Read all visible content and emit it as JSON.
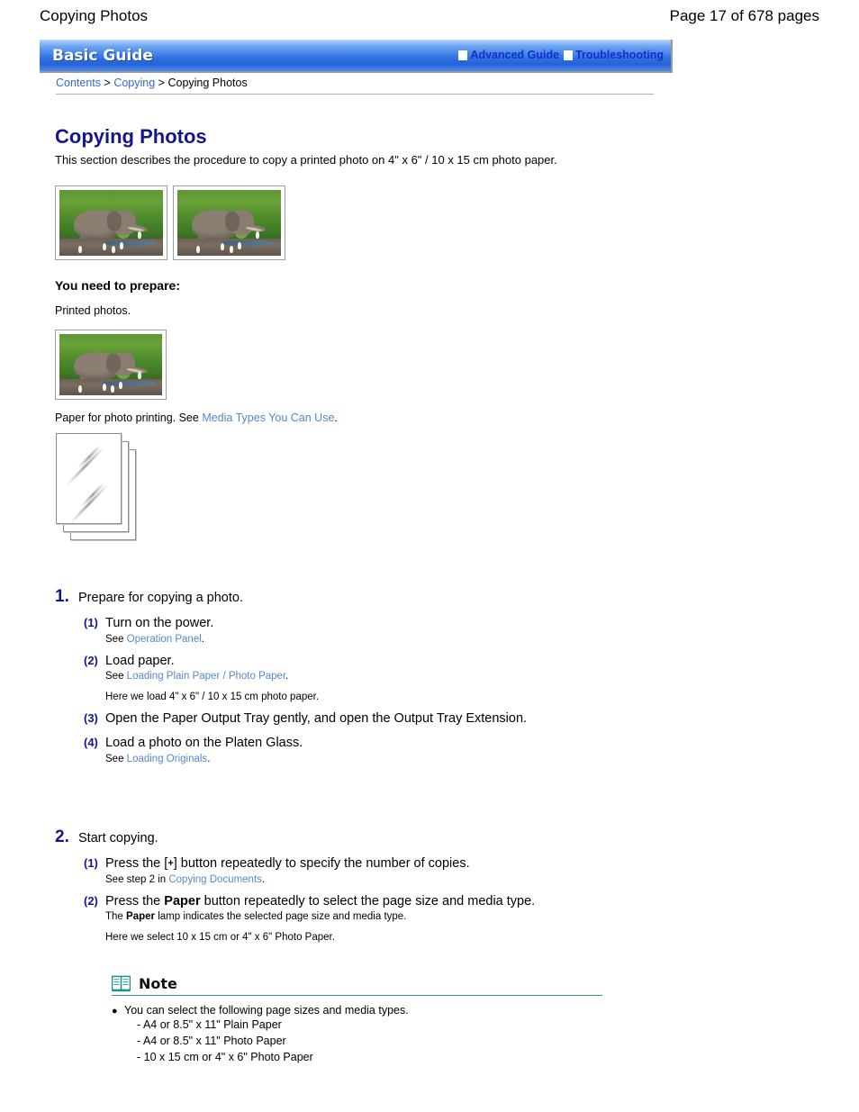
{
  "page_header": {
    "title": "Copying Photos",
    "page_indicator": "Page 17 of 678 pages"
  },
  "guide_bar": {
    "brand": "Basic Guide",
    "links": [
      {
        "label": "Advanced Guide",
        "icon": "white-square-icon"
      },
      {
        "label": "Troubleshooting",
        "icon": "white-square-icon"
      }
    ],
    "gradient_top": "#b8d4fa",
    "gradient_bottom": "#2464d8",
    "link_color": "#1030c8"
  },
  "breadcrumb": {
    "items": [
      {
        "label": "Contents",
        "link": true
      },
      {
        "label": "Copying",
        "link": true
      },
      {
        "label": "Copying Photos",
        "link": false
      }
    ],
    "separator": ">",
    "link_color": "#3366dd"
  },
  "document": {
    "title": "Copying Photos",
    "title_color": "#12188c",
    "intro": "This section describes the procedure to copy a printed photo on 4\" x 6\" / 10 x 15 cm photo paper."
  },
  "photos": {
    "top_row": [
      {
        "alt": "elephant-photo"
      },
      {
        "alt": "elephant-photo"
      }
    ],
    "single": {
      "alt": "elephant-photo"
    }
  },
  "prepare": {
    "heading": "You need to prepare:",
    "printed_photos": "Printed photos.",
    "paper_text_before": "Paper for photo printing. See",
    "paper_link": "Media Types You Can Use",
    "paper_text_after": "."
  },
  "steps": [
    {
      "number": "1.",
      "title": "Prepare for copying a photo.",
      "substeps": [
        {
          "number": "(1)",
          "title": "Turn on the power.",
          "note_before": "See",
          "note_link": "Operation Panel",
          "note_after": "."
        },
        {
          "number": "(2)",
          "title": "Load paper.",
          "note_before": "See",
          "note_link": "Loading Plain Paper / Photo Paper",
          "note_after": ".",
          "extra_note": "Here we load 4\" x 6\" / 10 x 15 cm photo paper."
        },
        {
          "number": "(3)",
          "title": "Open the Paper Output Tray gently, and open the Output Tray Extension."
        },
        {
          "number": "(4)",
          "title": "Load a photo on the Platen Glass.",
          "note_before": "See",
          "note_link": "Loading Originals",
          "note_after": "."
        }
      ]
    },
    {
      "number": "2.",
      "title": "Start copying.",
      "substeps": [
        {
          "number": "(1)",
          "title_part1": "Press the [",
          "title_key": "+",
          "title_part2": "] button repeatedly to specify the number of copies.",
          "note_before": "See step 2 in",
          "note_link": "Copying Documents",
          "note_after": "."
        },
        {
          "number": "(2)",
          "title_part1": "Press the",
          "title_bold": "Paper",
          "title_part2": "button repeatedly to select the page size and media type.",
          "note_before": "The",
          "note_bold": "Paper",
          "note_after_bold": "lamp indicates the selected page size and media type.",
          "extra_note": "Here we select 10 x 15 cm or 4\" x 6\" Photo Paper."
        }
      ]
    }
  ],
  "note_box": {
    "icon": "open-book-icon",
    "label": "Note",
    "rule_color": "#2f9c9c",
    "bullet_text": "You can select the following page sizes and media types.",
    "options": [
      "- A4 or 8.5\" x 11\" Plain Paper",
      "- A4 or 8.5\" x 11\" Photo Paper",
      "- 10 x 15 cm or 4\" x 6\" Photo Paper"
    ]
  }
}
